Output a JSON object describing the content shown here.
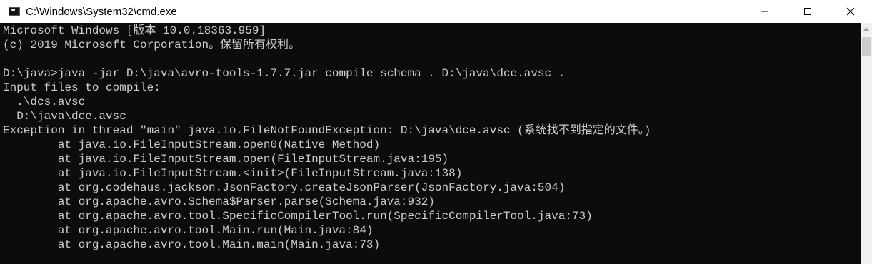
{
  "window": {
    "title": "C:\\Windows\\System32\\cmd.exe",
    "icon": "cmd-console-icon",
    "controls": [
      "minimize-icon",
      "maximize-icon",
      "close-icon"
    ]
  },
  "console": {
    "text_color": "#cccccc",
    "background": "#0c0c0c",
    "lines": [
      "Microsoft Windows [版本 10.0.18363.959]",
      "(c) 2019 Microsoft Corporation。保留所有权利。",
      "",
      "D:\\java>java -jar D:\\java\\avro-tools-1.7.7.jar compile schema . D:\\java\\dce.avsc .",
      "Input files to compile:",
      "  .\\dcs.avsc",
      "  D:\\java\\dce.avsc",
      "Exception in thread \"main\" java.io.FileNotFoundException: D:\\java\\dce.avsc (系统找不到指定的文件。)",
      "        at java.io.FileInputStream.open0(Native Method)",
      "        at java.io.FileInputStream.open(FileInputStream.java:195)",
      "        at java.io.FileInputStream.<init>(FileInputStream.java:138)",
      "        at org.codehaus.jackson.JsonFactory.createJsonParser(JsonFactory.java:504)",
      "        at org.apache.avro.Schema$Parser.parse(Schema.java:932)",
      "        at org.apache.avro.tool.SpecificCompilerTool.run(SpecificCompilerTool.java:73)",
      "        at org.apache.avro.tool.Main.run(Main.java:84)",
      "        at org.apache.avro.tool.Main.main(Main.java:73)"
    ]
  }
}
